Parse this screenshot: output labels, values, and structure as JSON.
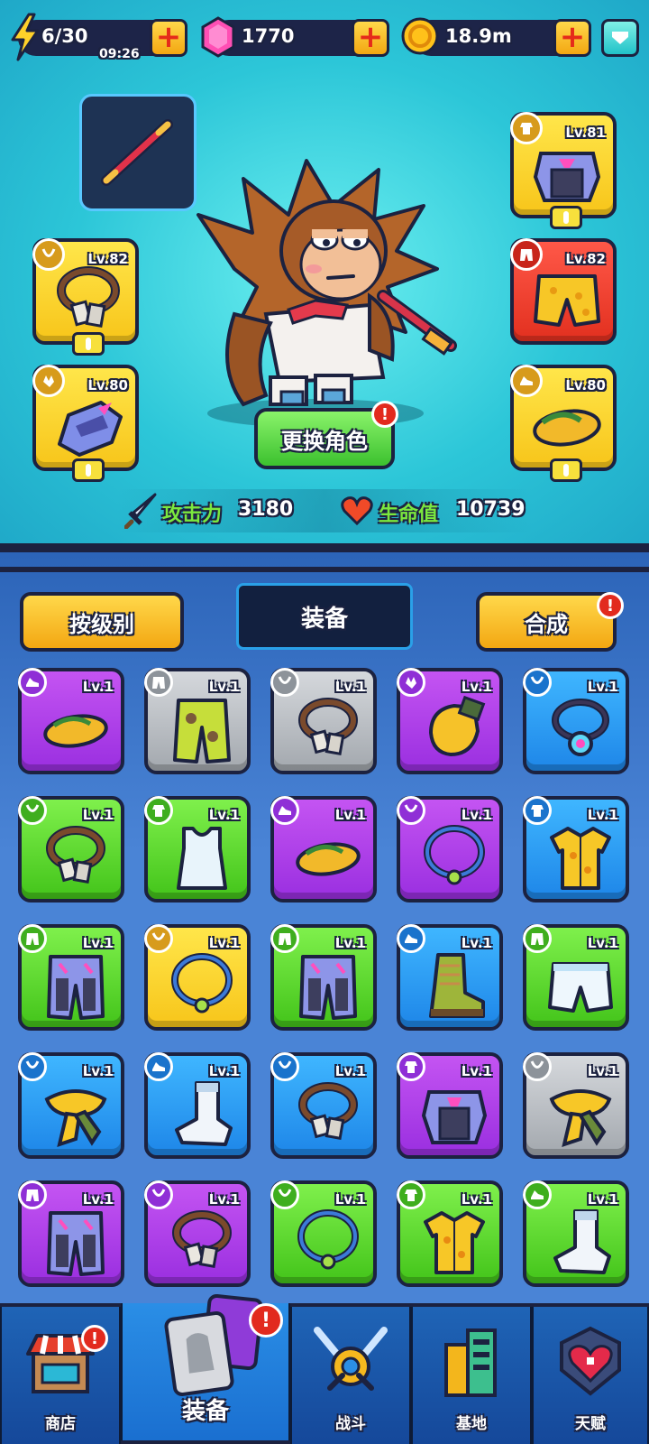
{
  "resources": {
    "energy": "6/30",
    "energy_timer": "09:26",
    "gems": "1770",
    "coins": "18.9m"
  },
  "hero": {
    "change_button": "更换角色",
    "change_badge": "!",
    "attack_label": "攻击力",
    "attack_value": "3180",
    "hp_label": "生命值",
    "hp_value": "10739"
  },
  "equipped": {
    "necklace_lv": "Lv.82",
    "glove_lv": "Lv.80",
    "armor_lv": "Lv.81",
    "pants_lv": "Lv.82",
    "shoes_lv": "Lv.80"
  },
  "panel": {
    "sort_button": "按级别",
    "title": "装备",
    "merge_button": "合成",
    "merge_badge": "!"
  },
  "inventory": [
    {
      "lv": "Lv.1",
      "rarity": "purple",
      "type": "shoes-icon",
      "art": "sandal"
    },
    {
      "lv": "Lv.1",
      "rarity": "gray",
      "type": "pants-icon",
      "art": "camo-pants"
    },
    {
      "lv": "Lv.1",
      "rarity": "gray",
      "type": "necklace-icon",
      "art": "dogtag"
    },
    {
      "lv": "Lv.1",
      "rarity": "purple",
      "type": "glove-icon",
      "art": "glove"
    },
    {
      "lv": "Lv.1",
      "rarity": "blue",
      "type": "necklace-icon",
      "art": "gem-necklace"
    },
    {
      "lv": "Lv.1",
      "rarity": "green",
      "type": "necklace-icon",
      "art": "dogtag"
    },
    {
      "lv": "Lv.1",
      "rarity": "green",
      "type": "armor-icon",
      "art": "tank-top"
    },
    {
      "lv": "Lv.1",
      "rarity": "purple",
      "type": "shoes-icon",
      "art": "sandal"
    },
    {
      "lv": "Lv.1",
      "rarity": "purple",
      "type": "necklace-icon",
      "art": "ring-necklace"
    },
    {
      "lv": "Lv.1",
      "rarity": "blue",
      "type": "armor-icon",
      "art": "hawaii-shirt"
    },
    {
      "lv": "Lv.1",
      "rarity": "green",
      "type": "pants-icon",
      "art": "mech-pants"
    },
    {
      "lv": "Lv.1",
      "rarity": "yellow",
      "type": "necklace-icon",
      "art": "ring-necklace"
    },
    {
      "lv": "Lv.1",
      "rarity": "green",
      "type": "pants-icon",
      "art": "mech-pants"
    },
    {
      "lv": "Lv.1",
      "rarity": "blue",
      "type": "shoes-icon",
      "art": "boot"
    },
    {
      "lv": "Lv.1",
      "rarity": "green",
      "type": "pants-icon",
      "art": "shorts"
    },
    {
      "lv": "Lv.1",
      "rarity": "blue",
      "type": "necklace-icon",
      "art": "scarf"
    },
    {
      "lv": "Lv.1",
      "rarity": "blue",
      "type": "shoes-icon",
      "art": "sock"
    },
    {
      "lv": "Lv.1",
      "rarity": "blue",
      "type": "necklace-icon",
      "art": "dogtag"
    },
    {
      "lv": "Lv.1",
      "rarity": "purple",
      "type": "armor-icon",
      "art": "mech-armor"
    },
    {
      "lv": "Lv.1",
      "rarity": "gray",
      "type": "necklace-icon",
      "art": "scarf"
    },
    {
      "lv": "Lv.1",
      "rarity": "purple",
      "type": "pants-icon",
      "art": "mech-pants"
    },
    {
      "lv": "Lv.1",
      "rarity": "purple",
      "type": "necklace-icon",
      "art": "dogtag"
    },
    {
      "lv": "Lv.1",
      "rarity": "green",
      "type": "necklace-icon",
      "art": "ring-necklace"
    },
    {
      "lv": "Lv.1",
      "rarity": "green",
      "type": "armor-icon",
      "art": "hawaii-shirt"
    },
    {
      "lv": "Lv.1",
      "rarity": "green",
      "type": "shoes-icon",
      "art": "sock"
    }
  ],
  "nav": {
    "shop": "商店",
    "equip": "装备",
    "battle": "战斗",
    "base": "基地",
    "talent": "天赋",
    "shop_badge": "!",
    "equip_badge": "!"
  }
}
